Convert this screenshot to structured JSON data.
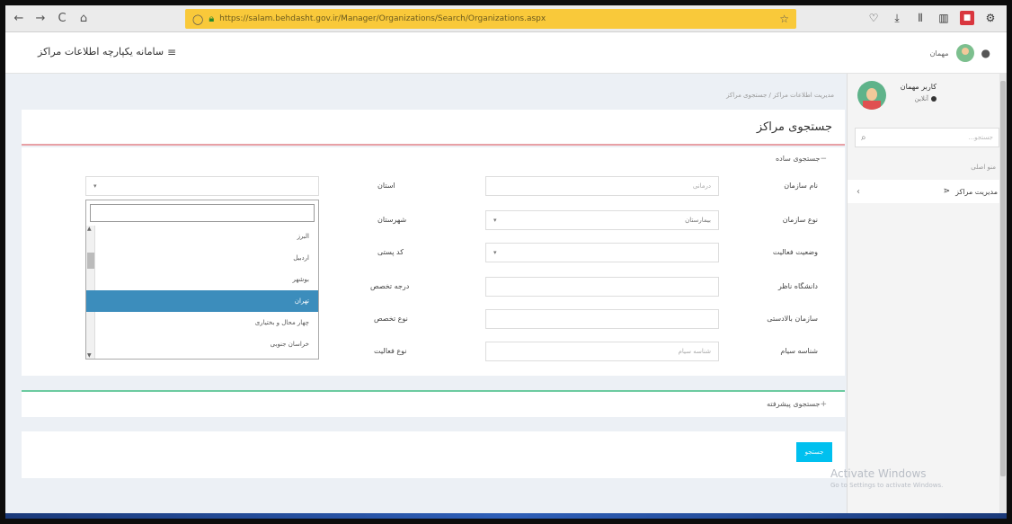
{
  "browser": {
    "nav_back": "←",
    "nav_forward": "→",
    "nav_reload": "C",
    "nav_home": "⌂",
    "url": "https://salam.behdasht.gov.ir/Manager/Organizations/Search/Organizations.aspx",
    "bookmark_star": "☆"
  },
  "header": {
    "app_title": "سامانه یکپارچه اطلاعات مراکز",
    "menu_toggle": "≡",
    "user_name": "مهمان"
  },
  "sidebar": {
    "profile_name": "کاربر مهمان",
    "profile_status": "آنلاین",
    "search_placeholder": "جستجو...",
    "section_label": "منو اصلی",
    "menu_item": "مدیریت مراکز"
  },
  "content": {
    "breadcrumb": "مدیریت اطلاعات مراکز / جستجوی مراکز",
    "page_title": "جستجوی مراکز",
    "simple_search_title": "جستجوی ساده",
    "advanced_search_title": "جستجوی پیشرفته",
    "search_button": "جستجو"
  },
  "form": {
    "org_name_label": "نام سازمان",
    "org_name_placeholder": "درمانی",
    "org_type_label": "نوع سازمان",
    "org_type_value": "بیمارستان",
    "activity_status_label": "وضعیت فعالیت",
    "university_label": "دانشگاه ناظر",
    "parent_org_label": "سازمان بالادستی",
    "sayam_label": "شناسه سیام",
    "sayam_placeholder": "شناسه سیام",
    "province_label": "استان",
    "city_label": "شهرستان",
    "postal_label": "کد پستی",
    "degree_label": "درجه تخصص",
    "specialty_label": "نوع تخصص",
    "activity_type_label": "نوع فعالیت"
  },
  "dropdown": {
    "items": [
      "البرز",
      "اردبیل",
      "بوشهر",
      "تهران",
      "چهار محال و بختیاری",
      "خراسان جنوبی"
    ],
    "selected_index": 3
  },
  "watermark": {
    "line1": "Activate Windows",
    "line2": "Go to Settings to activate Windows."
  },
  "colors": {
    "url_bar": "#f9c93a",
    "accent_blue": "#3c8dbc",
    "button_cyan": "#00c0ef",
    "title_border": "#e8a0a5",
    "advanced_border": "#6ccba0"
  }
}
